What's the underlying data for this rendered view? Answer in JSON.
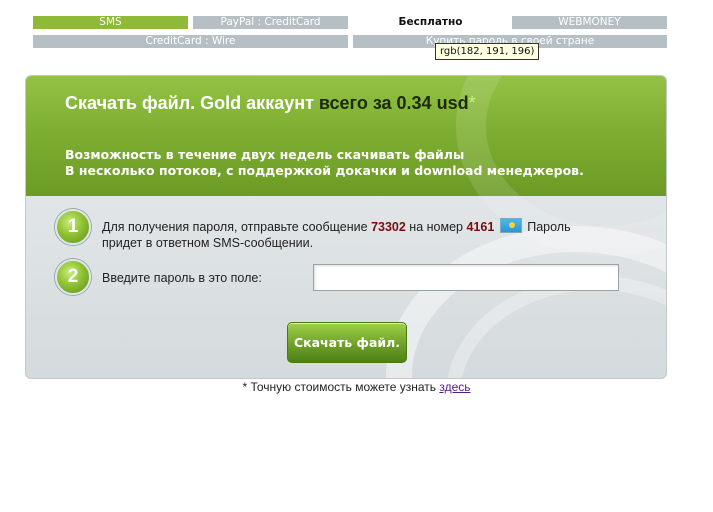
{
  "tabs_row1": [
    {
      "label": "SMS",
      "style": "green"
    },
    {
      "label": "PayPal : CreditCard",
      "style": "grey"
    },
    {
      "label": "Бесплатно",
      "style": "plain"
    },
    {
      "label": "WEBMONEY",
      "style": "grey"
    }
  ],
  "tabs_row2": [
    {
      "label": "CreditCard : Wire",
      "style": "grey"
    },
    {
      "label": "Купить пароль в своей стране",
      "style": "grey"
    }
  ],
  "tooltip": "rgb(182, 191, 196)",
  "header": {
    "title_main": "Скачать файл. Gold аккаунт ",
    "title_price": "всего за 0.34 usd",
    "title_star": "*",
    "line1": "Возможность в течение двух недель скачивать файлы",
    "line2": "В несколько потоков, с поддержкой докачки и download менеджеров."
  },
  "steps": [
    {
      "number": "1",
      "text_before": "Для получения пароля, отправьте сообщение ",
      "message_code": "73302",
      "text_middle": " на номер ",
      "short_number": "4161",
      "text_after": " Пароль",
      "text_line2": "придет в ответном SMS-сообщении."
    },
    {
      "number": "2",
      "label": "Введите пароль в это поле:"
    }
  ],
  "password_input": {
    "value": "",
    "placeholder": ""
  },
  "submit_label": "Скачать файл.",
  "footnote": {
    "text": "* Точную стоимость можете узнать ",
    "link": "здесь"
  },
  "colors": {
    "accent_green": "#7aab2e",
    "tab_grey": "#b6bfc4",
    "number_red": "#7a0d0d"
  },
  "icons": {
    "flag": "country-flag-icon"
  }
}
